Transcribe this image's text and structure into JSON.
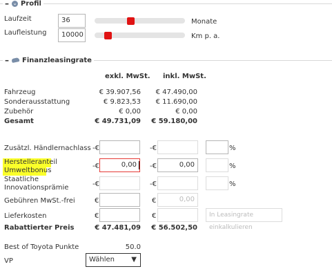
{
  "profile": {
    "title": "Profil",
    "laufzeit_label": "Laufzeit",
    "laufzeit_value": "36",
    "laufzeit_unit": "Monate",
    "laufzeit_slider_fraction": 0.39,
    "laufleistung_label": "Laufleistung",
    "laufleistung_value": "10000",
    "laufleistung_unit": "Km p. a.",
    "laufleistung_slider_fraction": 0.12
  },
  "finance": {
    "title": "Finanzleasingrate",
    "col_exkl": "exkl. MwSt.",
    "col_inkl": "inkl. MwSt.",
    "rows": [
      {
        "label": "Fahrzeug",
        "exkl": "€ 39.907,56",
        "inkl": "€ 47.490,00",
        "bold": false
      },
      {
        "label": "Sonderausstattung",
        "exkl": "€ 9.823,53",
        "inkl": "€ 11.690,00",
        "bold": false
      },
      {
        "label": "Zubehör",
        "exkl": "€ 0,00",
        "inkl": "€ 0,00",
        "bold": false
      },
      {
        "label": "Gesamt",
        "exkl": "€ 49.731,09",
        "inkl": "€ 59.180,00",
        "bold": true
      }
    ],
    "haendlernachlass_label": "Zusätzl. Händlernachlass",
    "minus_euro": "-€",
    "euro": "€",
    "percent": "%",
    "hersteller_line1": "Herstelleranteil",
    "hersteller_line2": "Umweltbonus",
    "hersteller_exkl": "0,00",
    "hersteller_inkl": "0,00",
    "innovation_line1": "Staatliche",
    "innovation_line2": "Innovationsprämie",
    "gebuehren_label": "Gebühren MwSt.-frei",
    "gebuehren_inkl": "0,00",
    "lieferkosten_label": "Lieferkosten",
    "lieferkosten_select": "In Leasingrate einkalkulieren",
    "rabattiert_label": "Rabattierter Preis",
    "rabattiert_exkl": "€ 47.481,09",
    "rabattiert_inkl": "€ 56.502,50",
    "toyota_label": "Best of Toyota Punkte",
    "toyota_value": "50.0",
    "vp_label": "VP",
    "vp_select": "Wählen"
  },
  "colors": {
    "slider_thumb": "#e01313",
    "error_border": "#e53935",
    "highlight": "#fbff2a"
  }
}
